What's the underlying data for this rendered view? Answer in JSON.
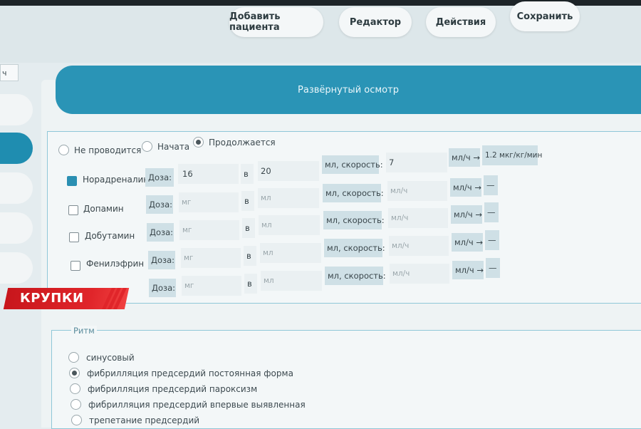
{
  "toolbar": {
    "buttons": [
      {
        "label": "Добавить пациента"
      },
      {
        "label": "Редактор"
      },
      {
        "label": "Действия"
      },
      {
        "label": "Сохранить"
      }
    ]
  },
  "left_field_value": "ч",
  "section": {
    "title": "Развёрнутый осмотр"
  },
  "status_options": [
    {
      "label": "Не проводится",
      "checked": false
    },
    {
      "label": "Начата",
      "checked": false
    },
    {
      "label": "Продолжается",
      "checked": true
    }
  ],
  "labels": {
    "dose": "Доза:",
    "in": "в",
    "ml_speed": "мл, скорость:",
    "ml_h_arrow": "мл/ч →",
    "placeholder_mg": "мг",
    "placeholder_ml": "мл",
    "placeholder_mlh": "мл/ч",
    "dash": "—"
  },
  "drugs": [
    {
      "name": "Норадреналин",
      "checked": true,
      "dose": "16",
      "volume": "20",
      "speed": "7",
      "result": "1.2 мкг/кг/мин"
    },
    {
      "name": "Допамин",
      "checked": false,
      "dose": "",
      "volume": "",
      "speed": "",
      "result": "—"
    },
    {
      "name": "Добутамин",
      "checked": false,
      "dose": "",
      "volume": "",
      "speed": "",
      "result": "—"
    },
    {
      "name": "Фенилэфрин",
      "checked": false,
      "dose": "",
      "volume": "",
      "speed": "",
      "result": "—"
    },
    {
      "name": "",
      "checked": false,
      "dose": "",
      "volume": "",
      "speed": "",
      "result": ""
    }
  ],
  "rhythm": {
    "title": "Ритм",
    "options": [
      {
        "label": "синусовый",
        "checked": false
      },
      {
        "label": "фибрилляция предсердий постоянная форма",
        "checked": true
      },
      {
        "label": "фибрилляция предсердий пароксизм",
        "checked": false
      },
      {
        "label": "фибрилляция предсердий впервые выявленная",
        "checked": false
      },
      {
        "label": "трепетание предсердий",
        "checked": false
      }
    ]
  },
  "overlay": {
    "caption": "КРУПКИ"
  },
  "colors": {
    "accent": "#2a94b6",
    "checkbox_checked": "#2a8fb2",
    "overlay_red": "#e0252a"
  }
}
